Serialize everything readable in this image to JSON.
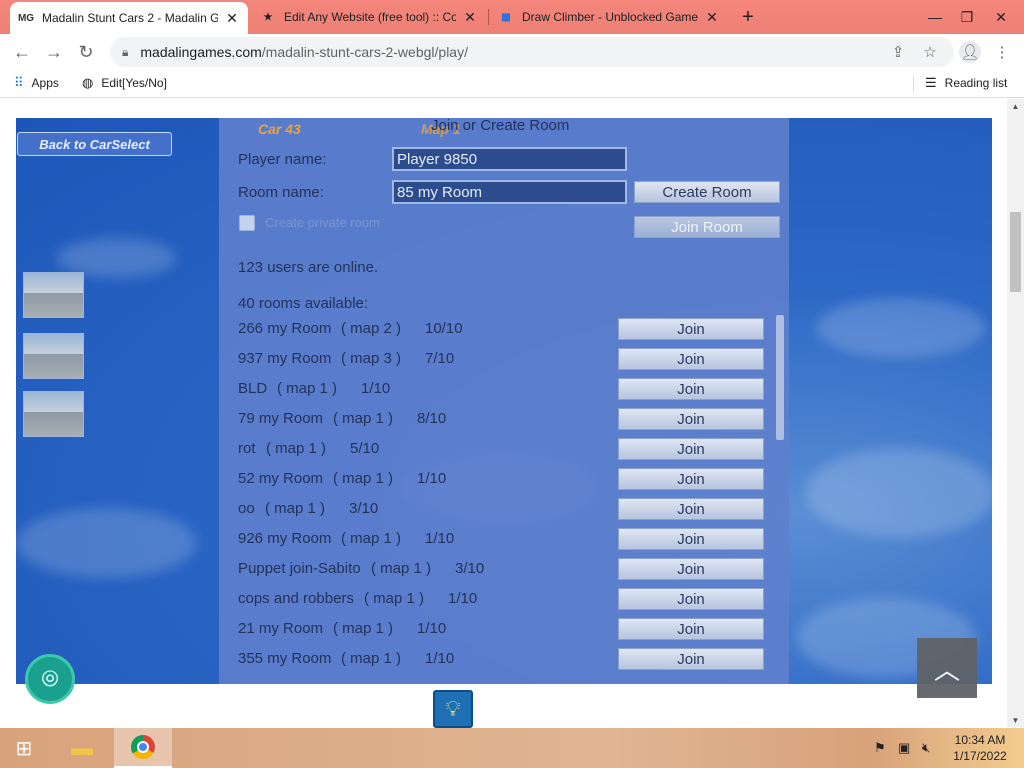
{
  "browser": {
    "tabs": [
      {
        "favicon": "MG",
        "title": "Madalin Stunt Cars 2 - Madalin G",
        "active": true
      },
      {
        "favicon": "★",
        "title": "Edit Any Website (free tool) :: Co",
        "active": false
      },
      {
        "favicon": "▦",
        "title": "Draw Climber - Unblocked Game",
        "active": false
      }
    ],
    "new_tab_icon": "plus-icon",
    "url_host": "madalingames.com",
    "url_path": "/madalin-stunt-cars-2-webgl/play/",
    "bookmarks": [
      {
        "label": "Apps",
        "icon": "grid-icon"
      },
      {
        "label": "Edit[Yes/No]",
        "icon": "globe-icon"
      }
    ],
    "reading_list": "Reading list"
  },
  "game": {
    "back_label": "Back to CarSelect",
    "car_label": "Car 43",
    "map_label": "Map 1",
    "heading": "Join or Create Room",
    "player_name_label": "Player name:",
    "player_name_value": "Player 9850",
    "room_name_label": "Room name:",
    "room_name_value": "85 my Room",
    "create_room": "Create Room",
    "join_room": "Join Room",
    "private_label": "Create private room",
    "users_online": "123 users are online.",
    "rooms_available": "40 rooms available:",
    "join_label": "Join",
    "rooms": [
      {
        "name": "266 my Room",
        "map": "( map 2 )",
        "count": "10/10"
      },
      {
        "name": "937 my Room",
        "map": "( map 3 )",
        "count": "7/10"
      },
      {
        "name": "BLD",
        "map": "( map 1 )",
        "count": "1/10"
      },
      {
        "name": "79 my Room",
        "map": "( map 1 )",
        "count": "8/10"
      },
      {
        "name": "rot",
        "map": "( map 1 )",
        "count": "5/10"
      },
      {
        "name": "52 my Room",
        "map": "( map 1 )",
        "count": "1/10"
      },
      {
        "name": "oo",
        "map": "( map 1 )",
        "count": "3/10"
      },
      {
        "name": "926 my Room",
        "map": "( map 1 )",
        "count": "1/10"
      },
      {
        "name": "Puppet join-Sabito",
        "map": "( map 1 )",
        "count": "3/10"
      },
      {
        "name": "cops and robbers",
        "map": "( map 1 )",
        "count": "1/10"
      },
      {
        "name": "21 my Room",
        "map": "( map 1 )",
        "count": "1/10"
      },
      {
        "name": "355 my Room",
        "map": "( map 1 )",
        "count": "1/10"
      }
    ]
  },
  "taskbar": {
    "time": "10:34 AM",
    "date": "1/17/2022"
  }
}
